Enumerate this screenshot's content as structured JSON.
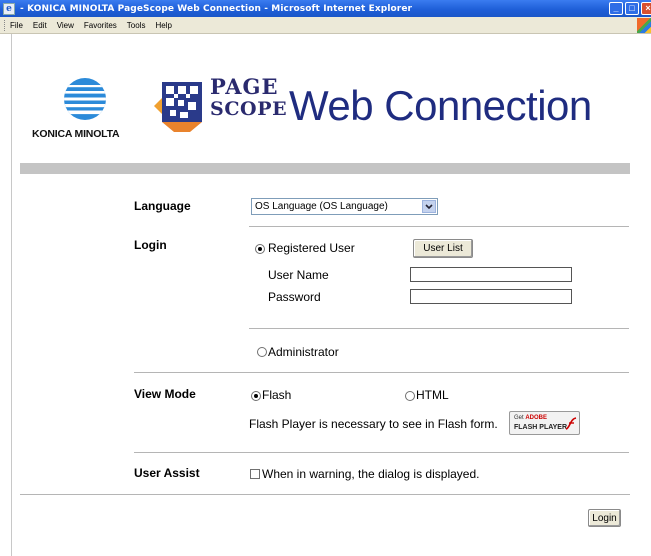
{
  "window": {
    "title": "- KONICA MINOLTA PageScope Web Connection - Microsoft Internet Explorer"
  },
  "menu": {
    "items": [
      "File",
      "Edit",
      "View",
      "Favorites",
      "Tools",
      "Help"
    ]
  },
  "header": {
    "brand_text": "KONICA MINOLTA",
    "product_page": "PAGE",
    "product_scope": "SCOPE",
    "product_title": "Web Connection"
  },
  "form": {
    "language": {
      "label": "Language",
      "selected": "OS Language (OS Language)"
    },
    "login": {
      "label": "Login",
      "registered_user": "Registered User",
      "user_list_button": "User List",
      "user_name_label": "User Name",
      "user_name_value": "",
      "password_label": "Password",
      "password_value": "",
      "administrator": "Administrator",
      "selected": "Registered User"
    },
    "view_mode": {
      "label": "View Mode",
      "flash": "Flash",
      "html": "HTML",
      "selected": "Flash",
      "flash_note": "Flash Player is necessary to see in Flash form.",
      "flash_badge_get": "Get",
      "flash_badge_adobe": "ADOBE",
      "flash_badge_name": "FLASH PLAYER"
    },
    "user_assist": {
      "label": "User Assist",
      "checkbox_text": "When in warning, the dialog is displayed.",
      "checked": false
    },
    "login_button": "Login"
  },
  "colors": {
    "title_blue": "#1f2c80",
    "brand_blue": "#2a8ad8",
    "band_gray": "#c4c4c4"
  }
}
